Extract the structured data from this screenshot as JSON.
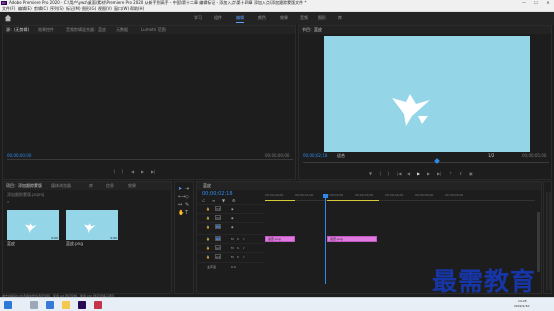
{
  "window": {
    "title": "Adobe Premiere Pro 2020 - C:\\用户\\ywz\\桌面\\素材\\Premiere Pro 2020 从新手到高手 - 中国\\第十二章 编辑标记 - 添加入点\\第十四章 添加入点\\添加跟踪蒙版文件 *",
    "min": "—",
    "max": "☐",
    "close": "✕"
  },
  "menu": [
    "文件(F)",
    "编辑(E)",
    "剪辑(C)",
    "序列(S)",
    "标记(M)",
    "图形(G)",
    "视图(V)",
    "窗口(W)",
    "帮助(H)"
  ],
  "workspaces": {
    "items": [
      "学习",
      "组件",
      "编辑",
      "颜色",
      "效果",
      "音频",
      "图形",
      "库"
    ],
    "active_index": 2
  },
  "source_panel": {
    "tabs": [
      "源：(无剪辑)",
      "效果控件",
      "音频剪辑混合器：蓝皮",
      "元数据",
      "Lumetri 范围"
    ],
    "left_timecode": "00;00;00;00",
    "right_timecode": "00;00;00;00"
  },
  "program_panel": {
    "tab": "节目：蓝皮",
    "timecode": "00;00;02;18",
    "fit": "适合",
    "fraction": "1/2",
    "end_timecode": "00;00;05;00"
  },
  "project_panel": {
    "tabs": [
      "项目：添加跟踪蒙版",
      "媒体浏览器",
      "库",
      "信息",
      "效果"
    ],
    "file": "添加跟踪蒙版.prproj",
    "items": [
      {
        "name": "蓝皮",
        "duration": "5:00"
      },
      {
        "name": "蓝皮.png",
        "duration": "5:00"
      }
    ]
  },
  "timeline": {
    "tab": "蓝皮",
    "timecode": "00;00;02;18",
    "ruler": [
      "00;00;00;00",
      "00;00;01;00",
      "00;00;02;00",
      "00;00;03;00",
      "00;00;04;00",
      "00;00;05;00",
      "00;00;06;00"
    ],
    "video_tracks": [
      "V3",
      "V2",
      "V1"
    ],
    "audio_tracks": [
      "A1",
      "A2",
      "A3"
    ],
    "master": "主声道",
    "master_value": "0.0",
    "clips": [
      "蓝皮.png",
      "蓝皮.png"
    ]
  },
  "status": "单击并拖动以在选择中修剪选定剪辑，使用 Alt 键可复制，使用 Ctrl 键可选择子项目",
  "tray": {
    "time": "14:25",
    "date": "2022/1/10"
  },
  "watermark": "最需教育",
  "colors": {
    "accent": "#2d8ceb",
    "clip": "#e07ae0",
    "sky": "#94d5e7",
    "watermark": "#1636a8"
  }
}
